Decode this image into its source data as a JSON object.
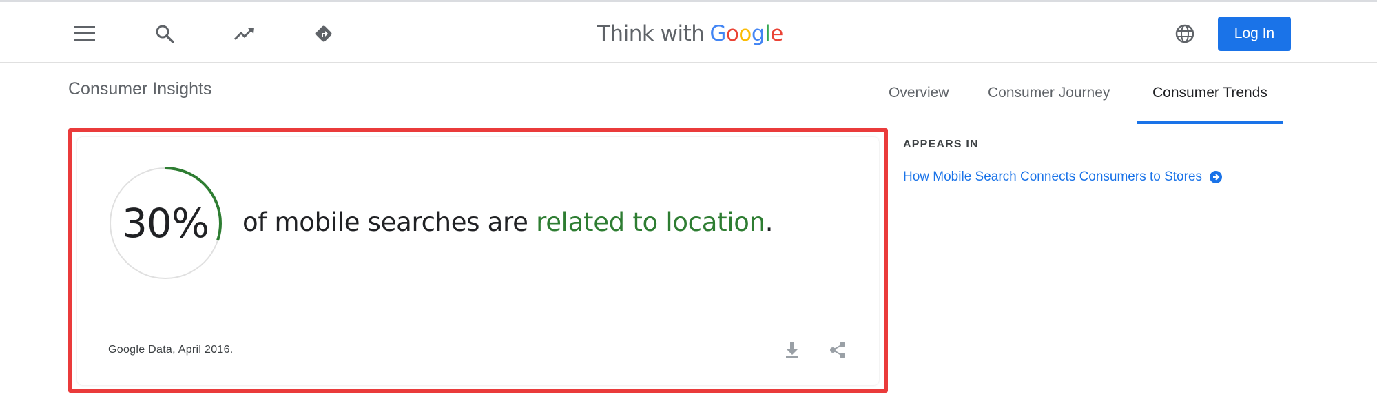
{
  "header": {
    "brand_prefix": "Think with",
    "brand_google": [
      "G",
      "o",
      "o",
      "g",
      "l",
      "e"
    ],
    "login_label": "Log In",
    "icons": [
      "menu-icon",
      "search-icon",
      "trending-up-icon",
      "diamond-directions-icon",
      "globe-icon"
    ]
  },
  "subnav": {
    "section_title": "Consumer Insights",
    "tabs": [
      {
        "label": "Overview",
        "active": false
      },
      {
        "label": "Consumer Journey",
        "active": false
      },
      {
        "label": "Consumer Trends",
        "active": true
      }
    ]
  },
  "stat_card": {
    "percent_label": "30%",
    "percent_value": 0.3,
    "text_plain": "of mobile searches are ",
    "text_highlight": "related to location",
    "text_end": ".",
    "source": "Google Data, April 2016.",
    "ring_color": "#2e7d32",
    "highlight_color": "#2e7d32",
    "actions": [
      "download-icon",
      "share-icon"
    ]
  },
  "sidebar": {
    "appears_in_label": "APPEARS IN",
    "link_label": "How Mobile Search Connects Consumers to Stores"
  },
  "colors": {
    "accent": "#1a73e8",
    "frame": "#ea3b3b"
  }
}
